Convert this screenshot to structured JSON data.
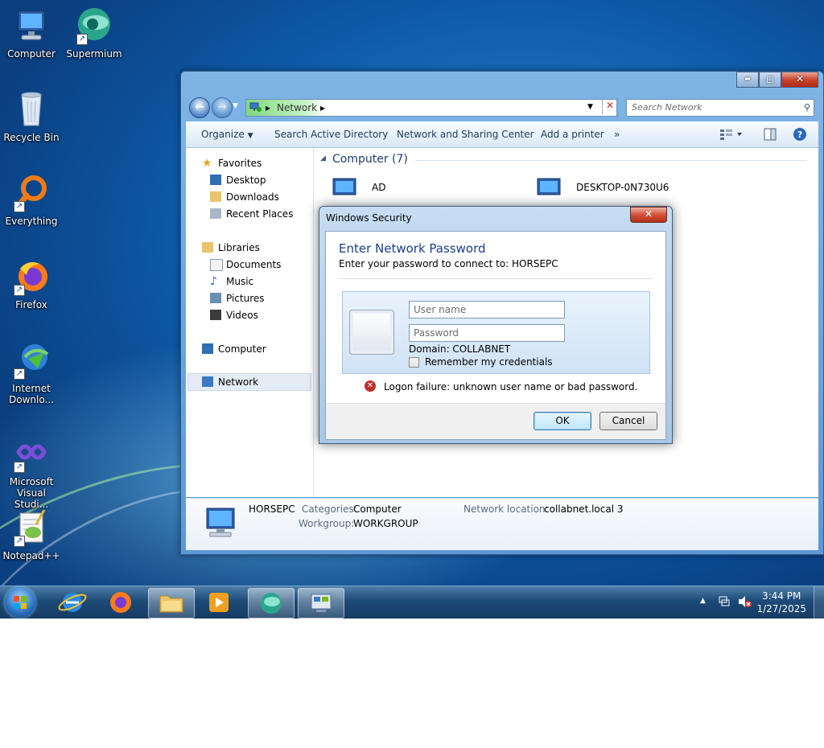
{
  "desktop": {
    "icons": [
      {
        "label": "Computer"
      },
      {
        "label": "Supermium"
      },
      {
        "label": "Recycle Bin"
      },
      {
        "label": "Everything"
      },
      {
        "label": "Firefox"
      },
      {
        "label": "Internet Downlo..."
      },
      {
        "label": "Microsoft Visual Studi..."
      },
      {
        "label": "Notepad++"
      }
    ]
  },
  "explorer": {
    "caption_buttons": {
      "minimize": "▬",
      "maximize": "◻",
      "close": "✕"
    },
    "address": {
      "segment": "Network",
      "arrow": "▸"
    },
    "search": {
      "placeholder": "Search Network"
    },
    "toolbar": {
      "organize": "Organize",
      "search_ad": "Search Active Directory",
      "network_center": "Network and Sharing Center",
      "add_printer": "Add a printer",
      "more": "»"
    },
    "nav": {
      "favorites": "Favorites",
      "desktop": "Desktop",
      "downloads": "Downloads",
      "recent": "Recent Places",
      "libraries": "Libraries",
      "documents": "Documents",
      "music": "Music",
      "pictures": "Pictures",
      "videos": "Videos",
      "computer": "Computer",
      "network": "Network"
    },
    "content": {
      "group_header": "Computer (7)",
      "items": [
        "AD",
        "DESKTOP-0N730U6"
      ]
    },
    "details": {
      "name": "HORSEPC",
      "categories_label": "Categories:",
      "categories_value": "Computer",
      "workgroup_label": "Workgroup:",
      "workgroup_value": "WORKGROUP",
      "location_label": "Network location:",
      "location_value": "collabnet.local 3"
    }
  },
  "dialog": {
    "title": "Windows Security",
    "close": "✕",
    "heading": "Enter Network Password",
    "subheading": "Enter your password to connect to: HORSEPC",
    "username_placeholder": "User name",
    "password_placeholder": "Password",
    "domain": "Domain: COLLABNET",
    "remember": "Remember my credentials",
    "error": "Logon failure: unknown user name or bad password.",
    "ok": "OK",
    "cancel": "Cancel"
  },
  "taskbar": {
    "time": "3:44 PM",
    "date": "1/27/2025"
  },
  "colors": {
    "accent": "#1e395b",
    "heading_blue": "#1a3e8c",
    "error_red": "#c0302a"
  }
}
